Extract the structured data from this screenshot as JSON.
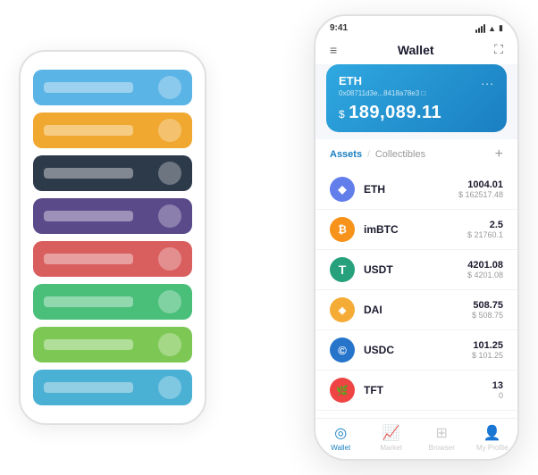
{
  "scene": {
    "back_phone": {
      "cards": [
        {
          "color": "card-blue",
          "label": "",
          "icon": ""
        },
        {
          "color": "card-yellow",
          "label": "",
          "icon": ""
        },
        {
          "color": "card-dark",
          "label": "",
          "icon": ""
        },
        {
          "color": "card-purple",
          "label": "",
          "icon": ""
        },
        {
          "color": "card-red",
          "label": "",
          "icon": ""
        },
        {
          "color": "card-green",
          "label": "",
          "icon": ""
        },
        {
          "color": "card-lightgreen",
          "label": "",
          "icon": ""
        },
        {
          "color": "card-lightblue",
          "label": "",
          "icon": ""
        }
      ]
    },
    "front_phone": {
      "status_bar": {
        "time": "9:41",
        "signal": "●●●",
        "wifi": "WiFi",
        "battery": "🔋"
      },
      "header": {
        "menu_label": "≡",
        "title": "Wallet",
        "expand_label": "⛶"
      },
      "eth_card": {
        "title": "ETH",
        "more_label": "...",
        "address": "0x08711d3e...8418a78e3 □",
        "currency_symbol": "$",
        "amount": "189,089.11"
      },
      "assets_section": {
        "tab_active": "Assets",
        "separator": "/",
        "tab_inactive": "Collectibles",
        "add_label": "+"
      },
      "assets": [
        {
          "name": "ETH",
          "icon_color": "#627eea",
          "icon_label": "◆",
          "main_amount": "1004.01",
          "usd_amount": "$ 162517.48"
        },
        {
          "name": "imBTC",
          "icon_color": "#f7931a",
          "icon_label": "₿",
          "main_amount": "2.5",
          "usd_amount": "$ 21760.1"
        },
        {
          "name": "USDT",
          "icon_color": "#26a17b",
          "icon_label": "T",
          "main_amount": "4201.08",
          "usd_amount": "$ 4201.08"
        },
        {
          "name": "DAI",
          "icon_color": "#f5ac37",
          "icon_label": "◎",
          "main_amount": "508.75",
          "usd_amount": "$ 508.75"
        },
        {
          "name": "USDC",
          "icon_color": "#2775ca",
          "icon_label": "©",
          "main_amount": "101.25",
          "usd_amount": "$ 101.25"
        },
        {
          "name": "TFT",
          "icon_color": "#ef4444",
          "icon_label": "🌿",
          "main_amount": "13",
          "usd_amount": "0"
        }
      ],
      "bottom_nav": [
        {
          "label": "Wallet",
          "icon": "◎",
          "active": true
        },
        {
          "label": "Market",
          "icon": "📊",
          "active": false
        },
        {
          "label": "Browser",
          "icon": "🌐",
          "active": false
        },
        {
          "label": "My Profile",
          "icon": "👤",
          "active": false
        }
      ]
    }
  }
}
